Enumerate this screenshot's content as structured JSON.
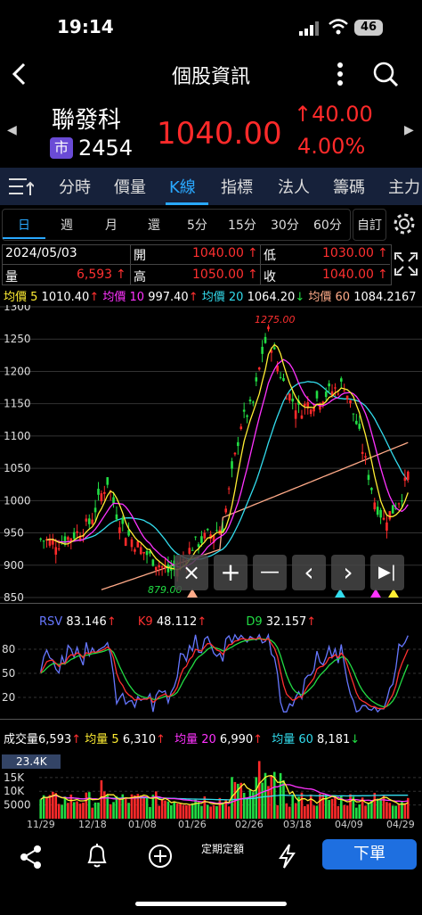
{
  "status_bar": {
    "time": "19:14",
    "battery": "46"
  },
  "nav": {
    "title": "個股資訊"
  },
  "quote": {
    "name": "聯發科",
    "market_badge": "市",
    "code": "2454",
    "price": "1040.00",
    "change": "40.00",
    "change_pct": "4.00%"
  },
  "tabs": [
    "分時",
    "價量",
    "K線",
    "指標",
    "法人",
    "籌碼",
    "主力"
  ],
  "active_tab": "K線",
  "periods": [
    "日",
    "週",
    "月",
    "還",
    "5分",
    "15分",
    "30分",
    "60分",
    "自訂"
  ],
  "active_period": "日",
  "info": {
    "date": "2024/05/03",
    "volume_label": "量",
    "volume_value": "6,593",
    "open_label": "開",
    "open_value": "1040.00",
    "high_label": "高",
    "high_value": "1050.00",
    "low_label": "低",
    "low_value": "1030.00",
    "close_label": "收",
    "close_value": "1040.00"
  },
  "moving_averages": [
    {
      "label": "均價 5",
      "value": "1010.40",
      "dir": "↑",
      "color": "#ffee33"
    },
    {
      "label": "均價 10",
      "value": "997.40",
      "dir": "↑",
      "color": "#ff33ff"
    },
    {
      "label": "均價 20",
      "value": "1064.20",
      "dir": "↓",
      "color": "#33ddee"
    },
    {
      "label": "均價 60",
      "value": "1084.2167",
      "dir": "",
      "color": "#ffaa88"
    }
  ],
  "price_axis": [
    "1300",
    "1250",
    "1200",
    "1150",
    "1100",
    "1050",
    "1000",
    "950",
    "900",
    "850"
  ],
  "price_high_label": "1275.00",
  "price_low_label": "879.00",
  "chart_tools": [
    "×",
    "+",
    "—",
    "‹",
    "›",
    "▶|"
  ],
  "kd": {
    "rsv_label": "RSV",
    "rsv_value": "83.146",
    "rsv_dir": "↑",
    "k_label": "K9",
    "k_value": "48.112",
    "k_dir": "↑",
    "d_label": "D9",
    "d_value": "32.157",
    "d_dir": "↑",
    "axis": [
      "80",
      "50",
      "20"
    ]
  },
  "volume_panel": {
    "label": "成交量",
    "value": "6,593",
    "dir": "↑",
    "ma5_label": "均量 5",
    "ma5_value": "6,310",
    "ma5_dir": "↑",
    "ma20_label": "均量 20",
    "ma20_value": "6,990",
    "ma20_dir": "↑",
    "ma60_label": "均量 60",
    "ma60_value": "8,181",
    "ma60_dir": "↓",
    "max_label": "23.4K",
    "axis": [
      "15K",
      "10K",
      "5000"
    ]
  },
  "x_axis": [
    "11/29",
    "12/18",
    "01/08",
    "01/26",
    "02/26",
    "03/18",
    "04/09",
    "04/29"
  ],
  "bottom_bar": {
    "schedule_label": "定期定額",
    "order_label": "下單"
  },
  "colors": {
    "up": "#ff2a2a",
    "down": "#22dd44",
    "accent": "#29a8ff"
  }
}
